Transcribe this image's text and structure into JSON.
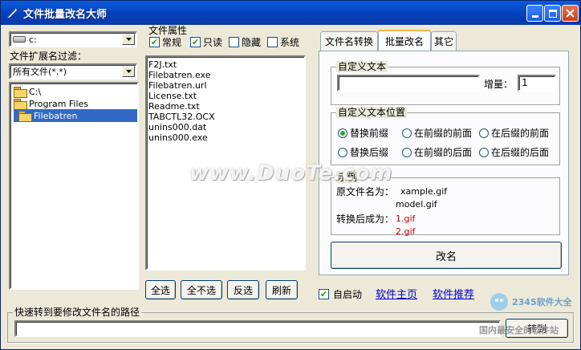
{
  "window": {
    "title": "文件批量改名大师"
  },
  "left": {
    "drive": "c:",
    "filter_label": "文件扩展名过滤：",
    "filter_value": "所有文件(*.*)",
    "tree": [
      {
        "label": "C:\\"
      },
      {
        "label": "Program Files"
      },
      {
        "label": "Filebatren"
      }
    ]
  },
  "attrs": {
    "title": "文件属性",
    "items": [
      {
        "label": "常规",
        "checked": true
      },
      {
        "label": "只读",
        "checked": true
      },
      {
        "label": "隐藏",
        "checked": false
      },
      {
        "label": "系统",
        "checked": false
      }
    ]
  },
  "files": [
    "F2J.txt",
    "Filebatren.exe",
    "Filebatren.url",
    "License.txt",
    "Readme.txt",
    "TABCTL32.OCX",
    "unins000.dat",
    "unins000.exe"
  ],
  "buttons": {
    "select_all": "全选",
    "select_none": "全不选",
    "invert": "反选",
    "refresh": "刷新",
    "rename": "改名",
    "goto": "转到"
  },
  "tabs": [
    {
      "label": "文件名转换"
    },
    {
      "label": "批量改名"
    },
    {
      "label": "其它"
    }
  ],
  "custom_text": {
    "title": "自定义文本",
    "value": "",
    "increment_label": "增量：",
    "increment_value": "1"
  },
  "position": {
    "title": "自定义文本位置",
    "options": [
      "替换前缀",
      "在前缀的前面",
      "在后缀的前面",
      "替换后缀",
      "在前缀的后面",
      "在后缀的后面"
    ],
    "selected": 0
  },
  "example": {
    "title": "示例",
    "orig_label": "原文件名为：",
    "orig_1": "xample.gif",
    "orig_2": "model.gif",
    "conv_label": "转换后成为：",
    "conv_1": "1.gif",
    "conv_2": "2.gif"
  },
  "bottom": {
    "autostart": "自启动",
    "home": "软件主页",
    "recommend": "软件推荐",
    "path_title": "快速转到要修改文件名的路径",
    "path_value": ""
  },
  "watermark": {
    "text": "www.DuoTe.com",
    "site": "国内最安全的软件站",
    "brand": "2345软件大全"
  }
}
